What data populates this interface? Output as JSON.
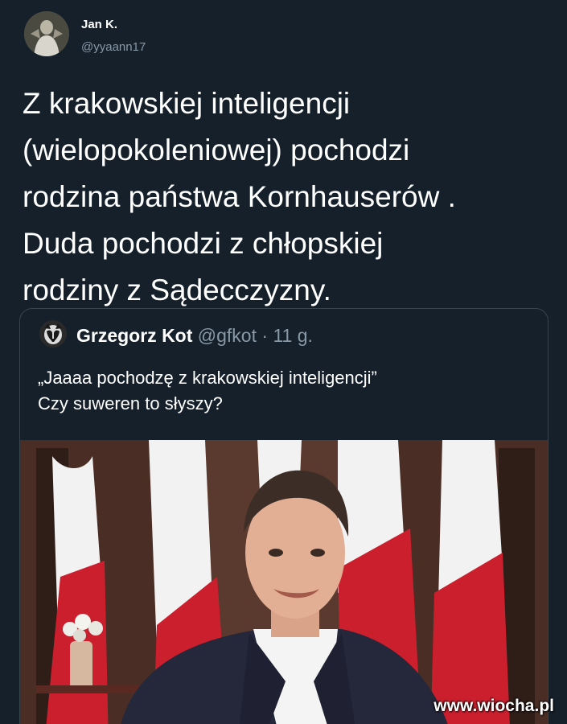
{
  "tweet": {
    "author": {
      "display_name": "Jan K.",
      "handle": "@yyaann17",
      "avatar_icon": "profile-photo"
    },
    "text": "Z krakowskiej inteligencji\n(wielopokoleniowej) pochodzi\nrodzina państwa Kornhauserów .\nDuda pochodzi z chłopskiej\nrodziny z Sądecczyzny.",
    "quoted_tweet": {
      "author": {
        "display_name": "Grzegorz Kot",
        "handle": "@gfkot",
        "avatar_icon": "profile-photo"
      },
      "separator": "·",
      "time": "11 g.",
      "text": "„Jaaaa pochodzę z krakowskiej inteligencji”\nCzy suweren to słyszy?",
      "media": {
        "type": "photo",
        "colors": {
          "flag_white": "#f2f2f2",
          "flag_red": "#cc1f2e",
          "background": "#4a2e25",
          "suit": "#25273a"
        }
      }
    }
  },
  "watermark": "www.wiocha.pl",
  "colors": {
    "background": "#15202b",
    "text_primary": "#ffffff",
    "text_secondary": "#8899a6",
    "border": "#38444d"
  }
}
